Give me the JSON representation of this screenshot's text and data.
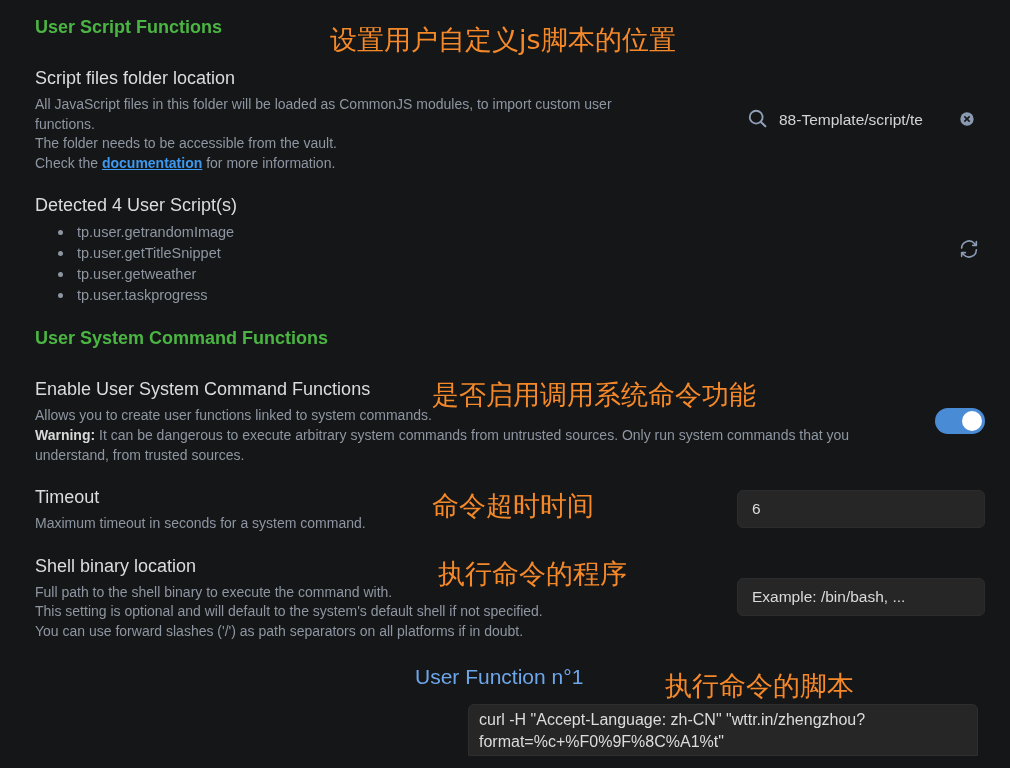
{
  "items": [
    {
      "kind": "header",
      "title": "User Script Functions"
    },
    {
      "kind": "setting",
      "name": "Script files folder location",
      "description": [
        "All JavaScript files in this folder will be loaded as CommonJS modules, to import custom user functions.",
        "The folder needs to be accessible from the vault.",
        {
          "before": "Check the ",
          "link": "documentation",
          "after": " for more information."
        }
      ],
      "control": {
        "kind": "search",
        "value": "88-Template/script/te"
      }
    },
    {
      "kind": "setting",
      "name": "Detected 4 User Script(s)",
      "list": [
        "tp.user.getrandomImage",
        "tp.user.getTitleSnippet",
        "tp.user.getweather",
        "tp.user.taskprogress"
      ],
      "control": {
        "kind": "refresh"
      }
    },
    {
      "kind": "header",
      "title": "User System Command Functions"
    },
    {
      "kind": "setting",
      "name": "Enable User System Command Functions",
      "description": [
        "Allows you to create user functions linked to system commands.",
        "**Warning:** It can be dangerous to execute arbitrary system commands from untrusted sources. Only run system commands that you understand, from trusted sources."
      ],
      "control": {
        "kind": "toggle",
        "on": true
      }
    },
    {
      "kind": "setting",
      "name": "Timeout",
      "description": [
        "Maximum timeout in seconds for a system command."
      ],
      "control": {
        "kind": "input",
        "value": "6"
      }
    },
    {
      "kind": "setting",
      "name": "Shell binary location",
      "description": [
        "Full path to the shell binary to execute the command with.",
        "This setting is optional and will default to the system's default shell if not specified.",
        "You can use forward slashes ('/') as path separators on all platforms if in doubt."
      ],
      "control": {
        "kind": "input",
        "placeholder": "Example: /bin/bash, ..."
      }
    },
    {
      "kind": "function",
      "title": "User Function n°1",
      "command": "curl -H \"Accept-Language: zh-CN\" \"wttr.in/zhengzhou?format=%c+%F0%9F%8C%A1%t\""
    }
  ],
  "annotations": [
    {
      "text": "设置用户自定义js脚本的位置"
    },
    {
      "text": "是否启用调用系统命令功能"
    },
    {
      "text": "命令超时时间"
    },
    {
      "text": "执行命令的程序"
    },
    {
      "text": "执行命令的脚本"
    }
  ]
}
